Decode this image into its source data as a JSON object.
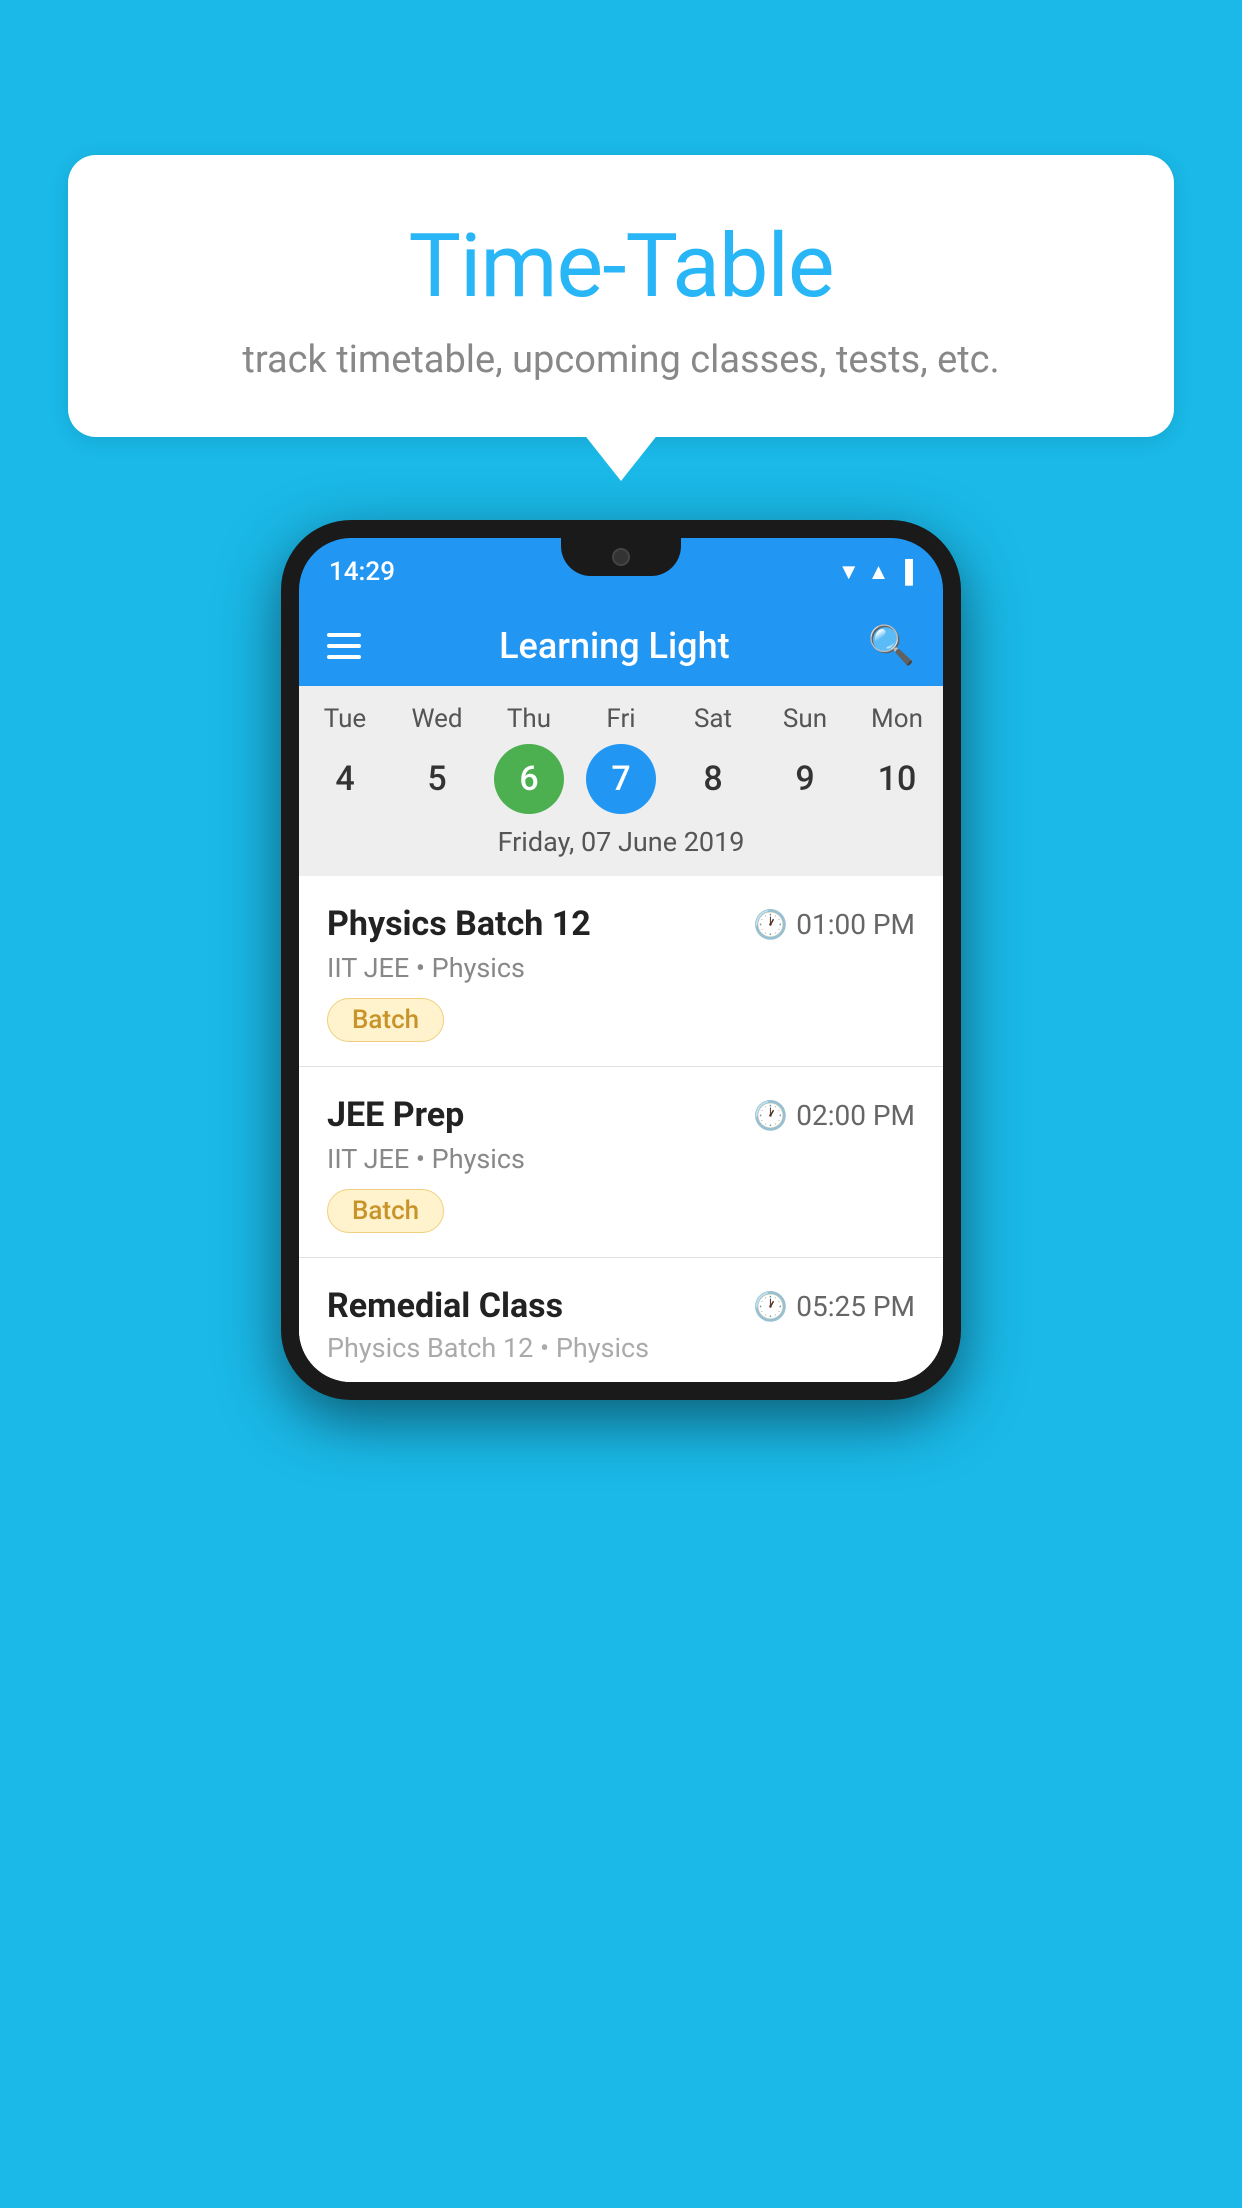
{
  "background_color": "#1ab9e8",
  "speech_bubble": {
    "title": "Time-Table",
    "subtitle": "track timetable, upcoming classes, tests, etc."
  },
  "phone": {
    "status_bar": {
      "time": "14:29",
      "icons": [
        "▲",
        "◀",
        "▐"
      ]
    },
    "app_header": {
      "title": "Learning Light"
    },
    "calendar": {
      "days": [
        {
          "name": "Tue",
          "num": "4",
          "state": "normal"
        },
        {
          "name": "Wed",
          "num": "5",
          "state": "normal"
        },
        {
          "name": "Thu",
          "num": "6",
          "state": "today"
        },
        {
          "name": "Fri",
          "num": "7",
          "state": "selected"
        },
        {
          "name": "Sat",
          "num": "8",
          "state": "normal"
        },
        {
          "name": "Sun",
          "num": "9",
          "state": "normal"
        },
        {
          "name": "Mon",
          "num": "10",
          "state": "normal"
        }
      ],
      "selected_date_label": "Friday, 07 June 2019"
    },
    "schedule": [
      {
        "title": "Physics Batch 12",
        "time": "01:00 PM",
        "subtitle": "IIT JEE • Physics",
        "tag": "Batch"
      },
      {
        "title": "JEE Prep",
        "time": "02:00 PM",
        "subtitle": "IIT JEE • Physics",
        "tag": "Batch"
      },
      {
        "title": "Remedial Class",
        "time": "05:25 PM",
        "subtitle": "Physics Batch 12 • Physics",
        "tag": null
      }
    ]
  }
}
